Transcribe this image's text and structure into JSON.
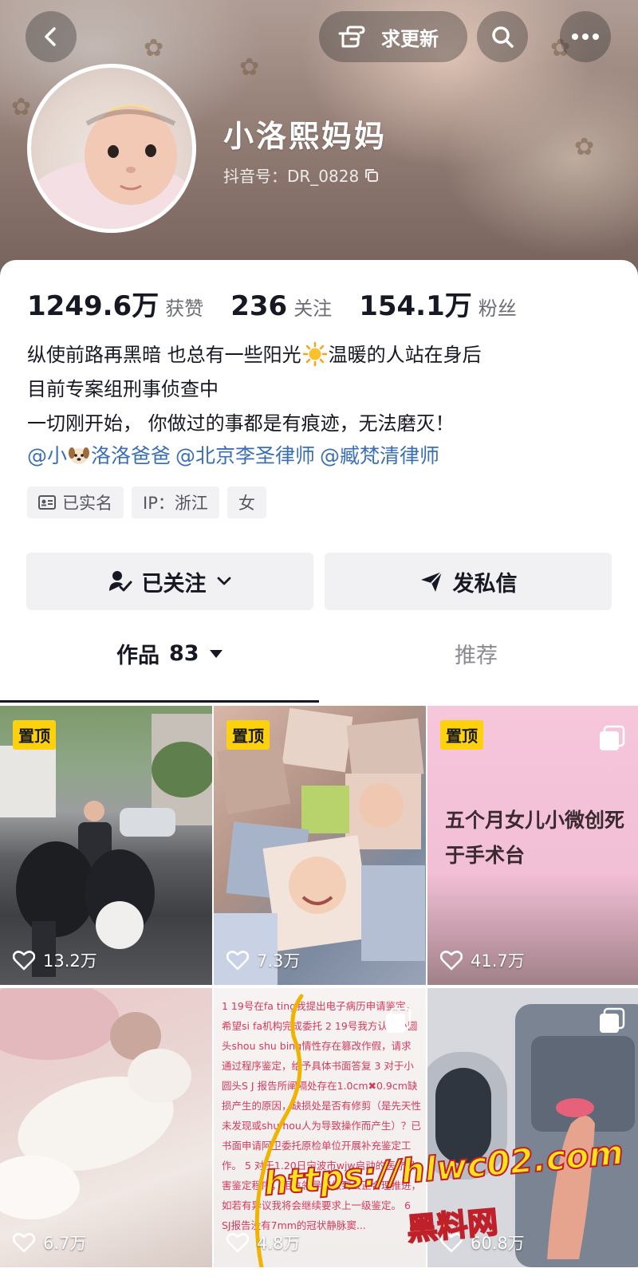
{
  "header": {
    "update_button_label": "求更新",
    "nickname": "小洛熙妈妈",
    "douyin_id": "抖音号：DR_0828"
  },
  "stats": [
    {
      "value": "1249.6万",
      "label": "获赞"
    },
    {
      "value": "236",
      "label": "关注"
    },
    {
      "value": "154.1万",
      "label": "粉丝"
    }
  ],
  "bio": {
    "line1_before": "纵使前路再黑暗 也总有一些阳光",
    "line1_after": "温暖的人站在身后",
    "line2": "目前专案组刑事侦查中",
    "line3": "一切刚开始， 你做过的事都是有痕迹，无法磨灭！",
    "mention1_before": "@小",
    "mention1_after": "洛洛爸爸",
    "mention2": "@北京李圣律师",
    "mention3": "@臧梵清律师"
  },
  "tags": [
    "已实名",
    "IP：浙江",
    "女"
  ],
  "actions": {
    "follow_label": "已关注",
    "message_label": "发私信"
  },
  "tabs": {
    "works_label": "作品",
    "works_count": "83",
    "recommend_label": "推荐"
  },
  "videos": [
    {
      "pinned": "置顶",
      "likes": "13.2万"
    },
    {
      "pinned": "置顶",
      "likes": "7.3万"
    },
    {
      "pinned": "置顶",
      "likes": "41.7万",
      "cover_text": "五个月女儿小微创死于手术台"
    },
    {
      "likes": "6.7万"
    },
    {
      "likes": "4.8万"
    },
    {
      "likes": "60.8万"
    }
  ],
  "video5_text": "1 19号在fa ting我提出电子病历申请鉴定，希望si fa机构完成委托 2 19号我方认为小圆头shou shu bing情性存在篡改作假，请求通过程序鉴定，给予具体书面答复 3 对于小圆头S J 报告所阐隔处存在1.0cm✖0.9cm缺损产生的原因，缺损处是否有修剪（是先天性未发现或shu hou人为导致操作而产生）？已书面申请阿卫委托原检单位开展补充鉴定工作。 5 对于1.20日宁波市wjw启动的医疗损害鉴定程序，相信领导组做到公正合理推进，如若有异议我将会继续要求上一级鉴定。 6 SJ报告没有7mm的冠状静脉窦...",
  "watermark": {
    "url": "https://hlwc02.com",
    "name": "黑料网"
  },
  "colors": {
    "pin_badge": "#fdd10d",
    "mention": "#3a6fb5",
    "text": "#161823"
  }
}
